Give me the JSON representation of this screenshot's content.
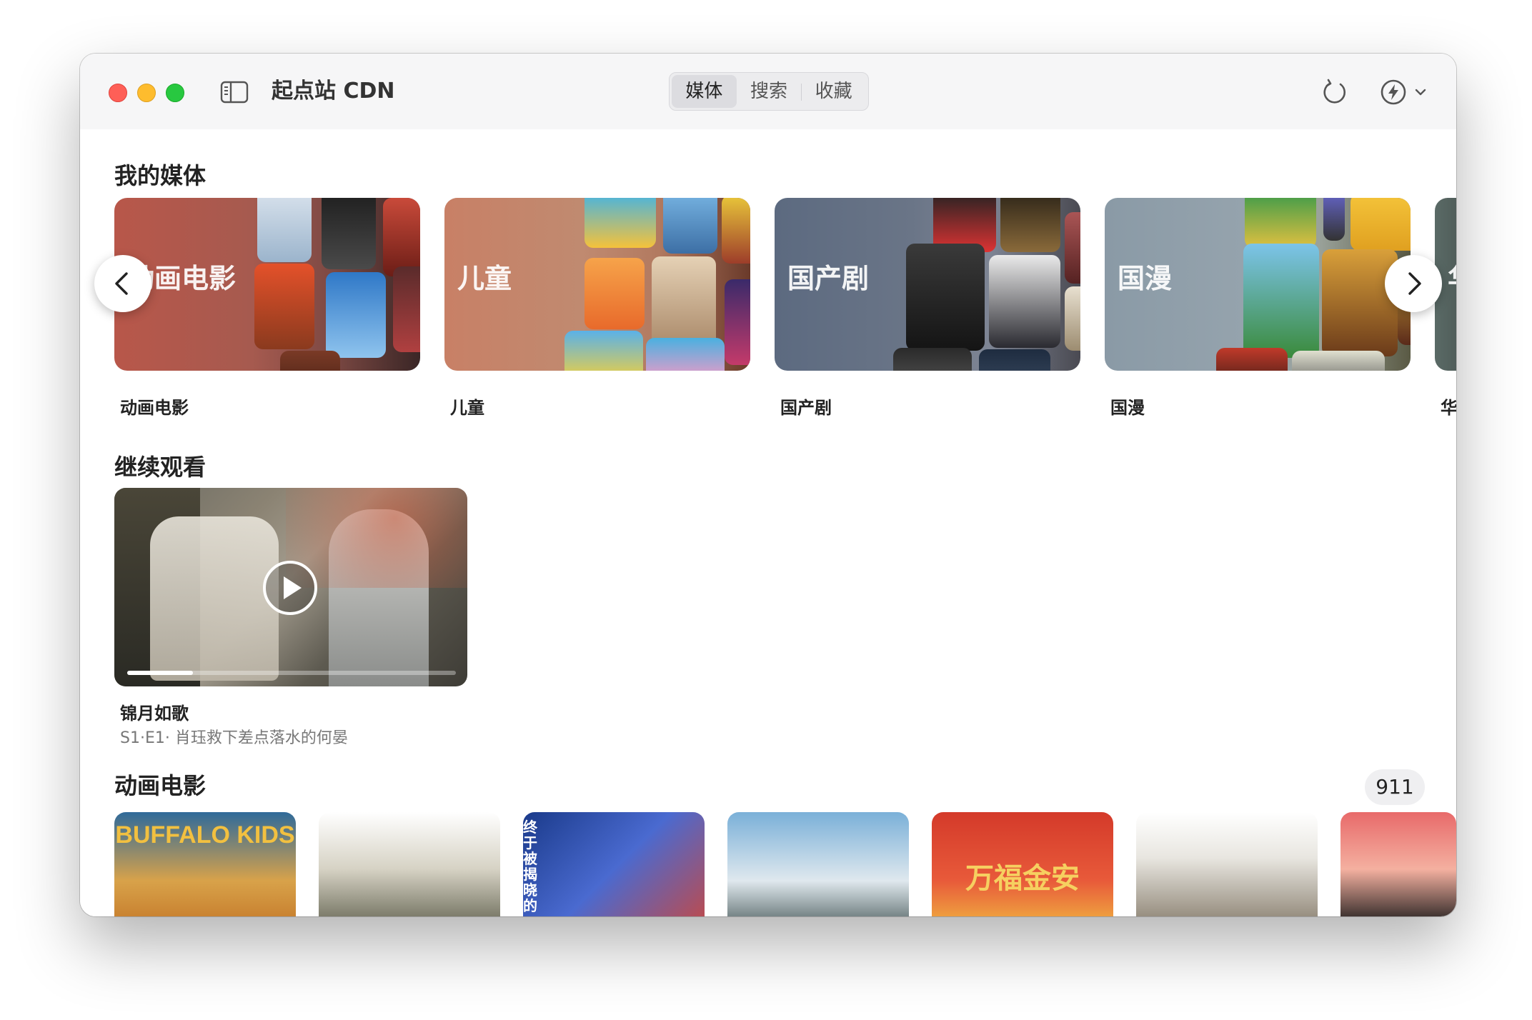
{
  "window": {
    "title": "起点站 CDN",
    "tabs": [
      {
        "label": "媒体",
        "active": true
      },
      {
        "label": "搜索",
        "active": false
      },
      {
        "label": "收藏",
        "active": false
      }
    ]
  },
  "my_media": {
    "title": "我的媒体",
    "items": [
      {
        "label": "动画电影",
        "overlay": "动画电影"
      },
      {
        "label": "儿童",
        "overlay": "儿童"
      },
      {
        "label": "国产剧",
        "overlay": "国产剧"
      },
      {
        "label": "国漫",
        "overlay": "国漫"
      },
      {
        "label": "华语",
        "overlay": "华语"
      }
    ]
  },
  "continue_watching": {
    "title": "继续观看",
    "item": {
      "title": "锦月如歌",
      "subtitle": "S1·E1· 肖珏救下差点落水的何晏",
      "progress": 0.2
    }
  },
  "animated_movies": {
    "title": "动画电影",
    "count": "911",
    "posters": [
      {
        "text": "BUFFALO KIDS"
      },
      {
        "text": ""
      },
      {
        "text": "终于被揭晓的"
      },
      {
        "text": ""
      },
      {
        "text": "万福金安"
      },
      {
        "text": ""
      },
      {
        "text": ""
      }
    ]
  },
  "icons": {
    "sidebar": "sidebar-toggle-icon",
    "refresh": "refresh-icon",
    "bolt": "bolt-icon",
    "prev": "chevron-left-icon",
    "next": "chevron-right-icon",
    "play": "play-icon"
  }
}
